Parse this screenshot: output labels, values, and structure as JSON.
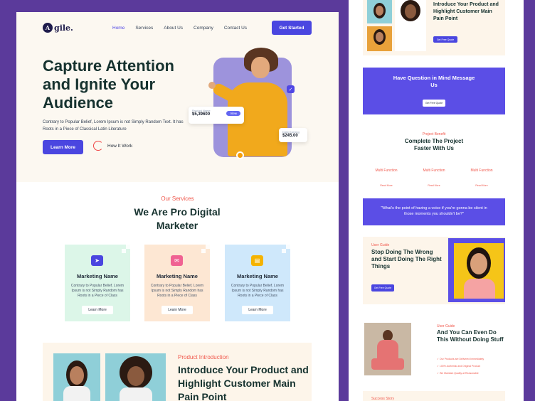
{
  "brand": {
    "logo_mark": "A",
    "logo_text": "gile."
  },
  "nav": {
    "items": [
      "Home",
      "Services",
      "About Us",
      "Company",
      "Contact Us"
    ],
    "cta": "Get Started"
  },
  "hero": {
    "title": "Capture Attention and Ignite Your Audience",
    "subtitle": "Contrary to Popular Belief, Lorem Ipsum is not Simply Random Text. It has Roots in a Piece of Classical Latin Literature",
    "primary_button": "Learn More",
    "secondary_link": "How It Work",
    "card1": {
      "label": "Product Name",
      "value": "$5,39600",
      "button": "View"
    },
    "card2": {
      "label": "Daily Earning",
      "value": "$245.00"
    }
  },
  "services": {
    "tag": "Our Services",
    "title": "We Are Pro Digital Marketer",
    "items": [
      {
        "name": "Marketing Name",
        "text": "Contrary to Popular Belief, Lorem Ipsum is not Simply Random has Roots in a Piece of Class",
        "button": "Learn More",
        "bg": "#dcf6e8",
        "icon_bg": "#4a46e0",
        "icon": "send-icon"
      },
      {
        "name": "Marketing Name",
        "text": "Contrary to Popular Belief, Lorem Ipsum is not Simply Random has Roots in a Piece of Class",
        "button": "Learn More",
        "bg": "#fde7d3",
        "icon_bg": "#f06292",
        "icon": "mail-icon"
      },
      {
        "name": "Marketing Name",
        "text": "Contrary to Popular Belief, Lorem Ipsum is not Simply Random has Roots in a Piece of Class",
        "button": "Learn More",
        "bg": "#cfe8fb",
        "icon_bg": "#f5b301",
        "icon": "document-icon"
      }
    ]
  },
  "product": {
    "tag": "Product Introduction",
    "title": "Introduce Your Product and Highlight Customer Main Pain Point"
  },
  "side": {
    "intro_title": "Introduce Your Product and Highlight Customer Main Pain Point",
    "intro_button": "Get Free Quote",
    "question_title": "Have Question in Mind Message Us",
    "question_button": "Get Free Quote",
    "benefit_tag": "Project Benefit",
    "benefit_title": "Complete The Project Faster With Us",
    "features": [
      "Multi Function",
      "Multi Function",
      "Multi Function"
    ],
    "feature_link": "Read More",
    "quote": "\"What's the point of having a voice if you're gonna be silent in those moments you shouldn't be?\"",
    "guide1_tag": "User Guide",
    "guide1_title": "Stop Doing The Wrong and Start Doing The Right Things",
    "guide1_button": "Get Free Quote",
    "guide2_tag": "User Guide",
    "guide2_title": "And You Can Even Do This Without Doing Stuff",
    "guide2_bullets": [
      "Our Products are Delivered Immediately",
      "100% Authentic and Original Product",
      "We Maintain Quality at Reasonable"
    ],
    "story_tag": "Success Story"
  }
}
